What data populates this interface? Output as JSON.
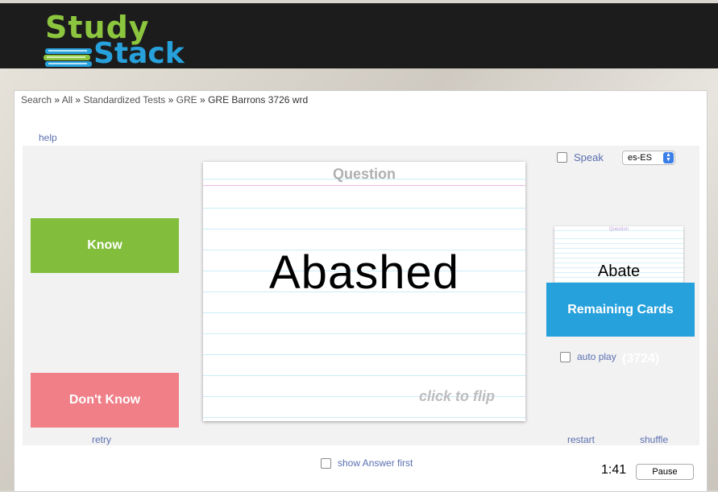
{
  "site": {
    "logo_top": "Study",
    "logo_bottom": "Stack"
  },
  "breadcrumb": [
    {
      "label": "Search",
      "link": true
    },
    {
      "label": "All",
      "link": true
    },
    {
      "label": "Standardized Tests",
      "link": true
    },
    {
      "label": "GRE",
      "link": true
    },
    {
      "label": "GRE Barrons 3726 wrd",
      "link": false
    }
  ],
  "breadcrumb_sep": "»",
  "help": "help",
  "buttons": {
    "know": "Know",
    "dont_know": "Don't Know",
    "retry": "retry",
    "remaining": "Remaining Cards"
  },
  "card": {
    "label": "Question",
    "word": "Abashed",
    "flip_hint": "click to flip"
  },
  "next_card": {
    "label": "Question",
    "word": "Abate"
  },
  "speak": {
    "label": "Speak",
    "checked": false
  },
  "language": {
    "selected": "es-ES"
  },
  "remaining_count": "(3724)",
  "auto_play": {
    "label": "auto play",
    "checked": false
  },
  "restart": "restart",
  "shuffle": "shuffle",
  "show_answer_first": {
    "label": "show Answer first",
    "checked": false
  },
  "timer": "1:41",
  "pause": "Pause",
  "colors": {
    "know": "#82be3b",
    "dont_know": "#f07f88",
    "remaining": "#27a1dc",
    "link": "#5a6fb0"
  }
}
